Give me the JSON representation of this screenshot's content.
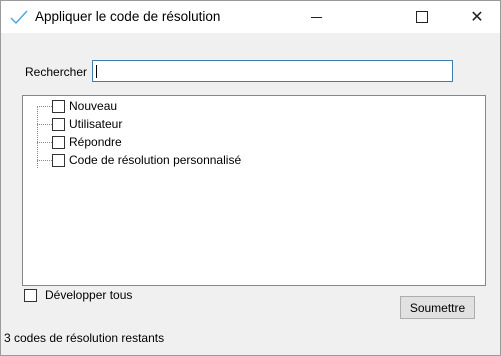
{
  "window": {
    "title": "Appliquer le code de résolution",
    "controls": {
      "minimize_icon": "minimize-icon",
      "maximize_icon": "maximize-icon",
      "close_label": "✕"
    }
  },
  "search": {
    "label": "Rechercher",
    "value": ""
  },
  "tree": {
    "items": [
      {
        "label": "Nouveau",
        "checked": false
      },
      {
        "label": "Utilisateur",
        "checked": false
      },
      {
        "label": "Répondre",
        "checked": false
      },
      {
        "label": "Code de résolution personnalisé",
        "checked": false
      }
    ]
  },
  "expand_all": {
    "label": "Développer tous",
    "checked": false
  },
  "submit": {
    "label": "Soumettre"
  },
  "status": {
    "text": "3 codes  de résolution restants"
  },
  "colors": {
    "accent": "#3c7fb1",
    "check_icon": "#4aa3df"
  }
}
